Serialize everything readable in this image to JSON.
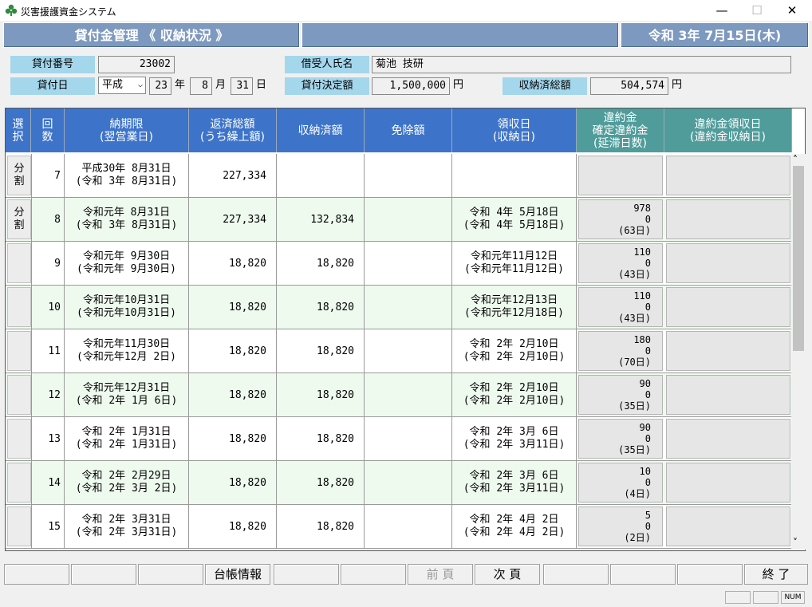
{
  "window": {
    "title": "災害援護資金システム",
    "minimize": "—",
    "maximize": "☐",
    "close": "✕"
  },
  "header": {
    "screen": "貸付金管理 《 収納状況 》",
    "middle": "",
    "date": "令和 3年 7月15日(木)"
  },
  "form": {
    "loan_no_label": "貸付番号",
    "loan_no": "23002",
    "borrower_label": "借受人氏名",
    "borrower": "菊池 技研",
    "loan_date_label": "貸付日",
    "era": "平成",
    "year": "23",
    "year_unit": "年",
    "month": "8",
    "month_unit": "月",
    "day": "31",
    "day_unit": "日",
    "decision_label": "貸付決定額",
    "decision": "1,500,000",
    "decision_unit": "円",
    "paid_total_label": "収納済総額",
    "paid_total": "504,574",
    "paid_total_unit": "円"
  },
  "columns": {
    "select": [
      "選",
      "択"
    ],
    "count": [
      "回",
      "数"
    ],
    "due": [
      "納期限",
      "(翌営業日)"
    ],
    "repay": [
      "返済総額",
      "(うち繰上額)"
    ],
    "paid": [
      "収納済額"
    ],
    "exempt": [
      "免除額"
    ],
    "receipt": [
      "領収日",
      "(収納日)"
    ],
    "penalty": [
      "違約金",
      "確定違約金",
      "(延滞日数)"
    ],
    "penalty_receipt": [
      "違約金領収日",
      "(違約金収納日)"
    ]
  },
  "rows": [
    {
      "select": [
        "分",
        "割"
      ],
      "count": "7",
      "due": [
        "平成30年 8月31日",
        "(令和 3年 8月31日)"
      ],
      "repay": "227,334",
      "paid": "",
      "exempt": "",
      "receipt": [
        "",
        ""
      ],
      "penalty": [
        "",
        "",
        ""
      ]
    },
    {
      "select": [
        "分",
        "割"
      ],
      "count": "8",
      "due": [
        "令和元年 8月31日",
        "(令和 3年 8月31日)"
      ],
      "repay": "227,334",
      "paid": "132,834",
      "exempt": "",
      "receipt": [
        "令和 4年 5月18日",
        "(令和 4年 5月18日)"
      ],
      "penalty": [
        "978",
        "0",
        "(63日)"
      ]
    },
    {
      "select": [
        "",
        ""
      ],
      "count": "9",
      "due": [
        "令和元年 9月30日",
        "(令和元年 9月30日)"
      ],
      "repay": "18,820",
      "paid": "18,820",
      "exempt": "",
      "receipt": [
        "令和元年11月12日",
        "(令和元年11月12日)"
      ],
      "penalty": [
        "110",
        "0",
        "(43日)"
      ]
    },
    {
      "select": [
        "",
        ""
      ],
      "count": "10",
      "due": [
        "令和元年10月31日",
        "(令和元年10月31日)"
      ],
      "repay": "18,820",
      "paid": "18,820",
      "exempt": "",
      "receipt": [
        "令和元年12月13日",
        "(令和元年12月18日)"
      ],
      "penalty": [
        "110",
        "0",
        "(43日)"
      ]
    },
    {
      "select": [
        "",
        ""
      ],
      "count": "11",
      "due": [
        "令和元年11月30日",
        "(令和元年12月 2日)"
      ],
      "repay": "18,820",
      "paid": "18,820",
      "exempt": "",
      "receipt": [
        "令和 2年 2月10日",
        "(令和 2年 2月10日)"
      ],
      "penalty": [
        "180",
        "0",
        "(70日)"
      ]
    },
    {
      "select": [
        "",
        ""
      ],
      "count": "12",
      "due": [
        "令和元年12月31日",
        "(令和 2年 1月 6日)"
      ],
      "repay": "18,820",
      "paid": "18,820",
      "exempt": "",
      "receipt": [
        "令和 2年 2月10日",
        "(令和 2年 2月10日)"
      ],
      "penalty": [
        "90",
        "0",
        "(35日)"
      ]
    },
    {
      "select": [
        "",
        ""
      ],
      "count": "13",
      "due": [
        "令和 2年 1月31日",
        "(令和 2年 1月31日)"
      ],
      "repay": "18,820",
      "paid": "18,820",
      "exempt": "",
      "receipt": [
        "令和 2年 3月 6日",
        "(令和 2年 3月11日)"
      ],
      "penalty": [
        "90",
        "0",
        "(35日)"
      ]
    },
    {
      "select": [
        "",
        ""
      ],
      "count": "14",
      "due": [
        "令和 2年 2月29日",
        "(令和 2年 3月 2日)"
      ],
      "repay": "18,820",
      "paid": "18,820",
      "exempt": "",
      "receipt": [
        "令和 2年 3月 6日",
        "(令和 2年 3月11日)"
      ],
      "penalty": [
        "10",
        "0",
        "(4日)"
      ]
    },
    {
      "select": [
        "",
        ""
      ],
      "count": "15",
      "due": [
        "令和 2年 3月31日",
        "(令和 2年 3月31日)"
      ],
      "repay": "18,820",
      "paid": "18,820",
      "exempt": "",
      "receipt": [
        "令和 2年 4月 2日",
        "(令和 2年 4月 2日)"
      ],
      "penalty": [
        "5",
        "0",
        "(2日)"
      ]
    }
  ],
  "scroll": {
    "up": "˄",
    "down": "˅"
  },
  "buttons": [
    "",
    "",
    "",
    "台帳情報",
    "",
    "",
    "前 頁",
    "次 頁",
    "",
    "",
    "",
    "終 了"
  ],
  "disabled_buttons": [
    6
  ],
  "status": [
    "",
    "",
    "NUM"
  ],
  "colors": {
    "header": "#7d99bf",
    "label": "#a4d6ec",
    "col_blue": "#3d74c9",
    "col_teal": "#4f9c9b",
    "row_alt": "#eefaee"
  }
}
